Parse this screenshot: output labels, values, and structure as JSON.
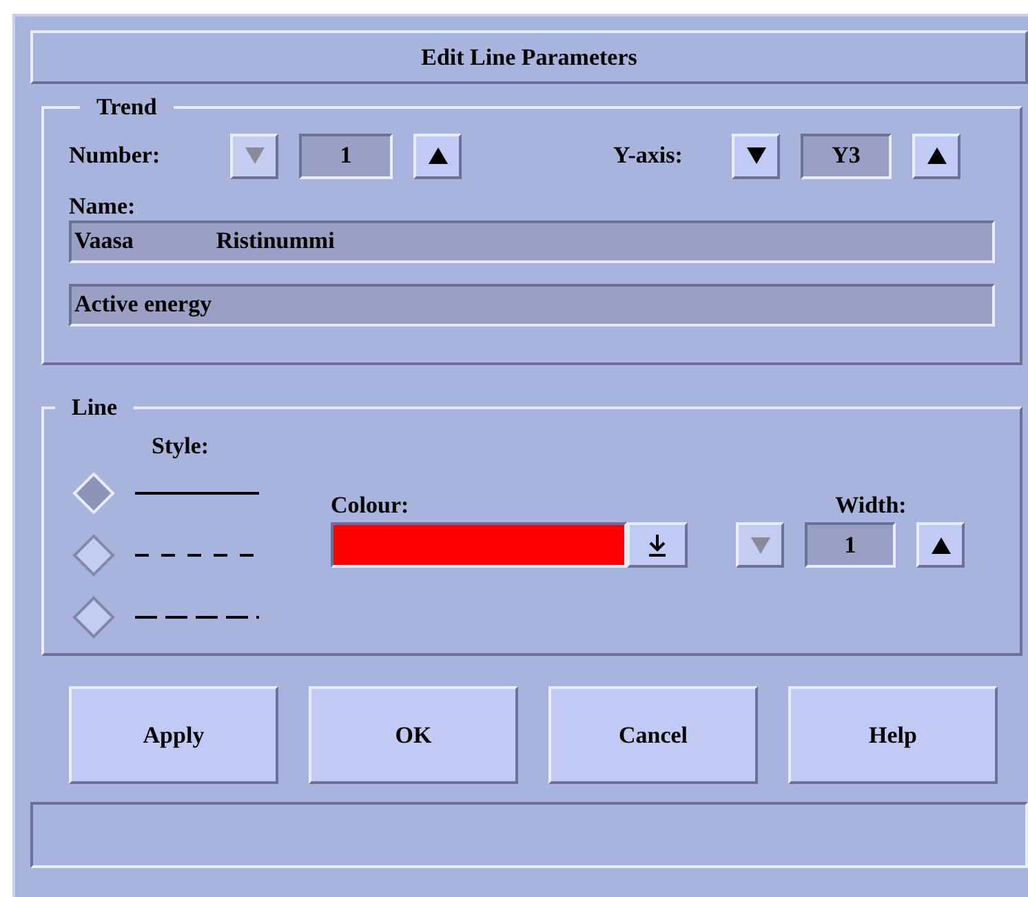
{
  "window": {
    "title": "Edit Line Parameters"
  },
  "trend": {
    "label": "Trend",
    "number": {
      "label": "Number:",
      "value": "1",
      "down_disabled": true,
      "up_disabled": false
    },
    "y_axis": {
      "label": "Y-axis:",
      "value": "Y3",
      "down_disabled": false,
      "up_disabled": false
    },
    "name_label": "Name:",
    "name_field": [
      "Vaasa",
      "Ristinummi"
    ],
    "description_field": "Active energy"
  },
  "line": {
    "label": "Line",
    "style_label": "Style:",
    "styles": [
      {
        "kind": "solid",
        "selected": true
      },
      {
        "kind": "dashed",
        "selected": false
      },
      {
        "kind": "long-dashed",
        "selected": false
      }
    ],
    "colour": {
      "label": "Colour:",
      "color": "#ff0000"
    },
    "width": {
      "label": "Width:",
      "value": "1",
      "down_disabled": true,
      "up_disabled": false
    }
  },
  "buttons": [
    "Apply",
    "OK",
    "Cancel",
    "Help"
  ]
}
